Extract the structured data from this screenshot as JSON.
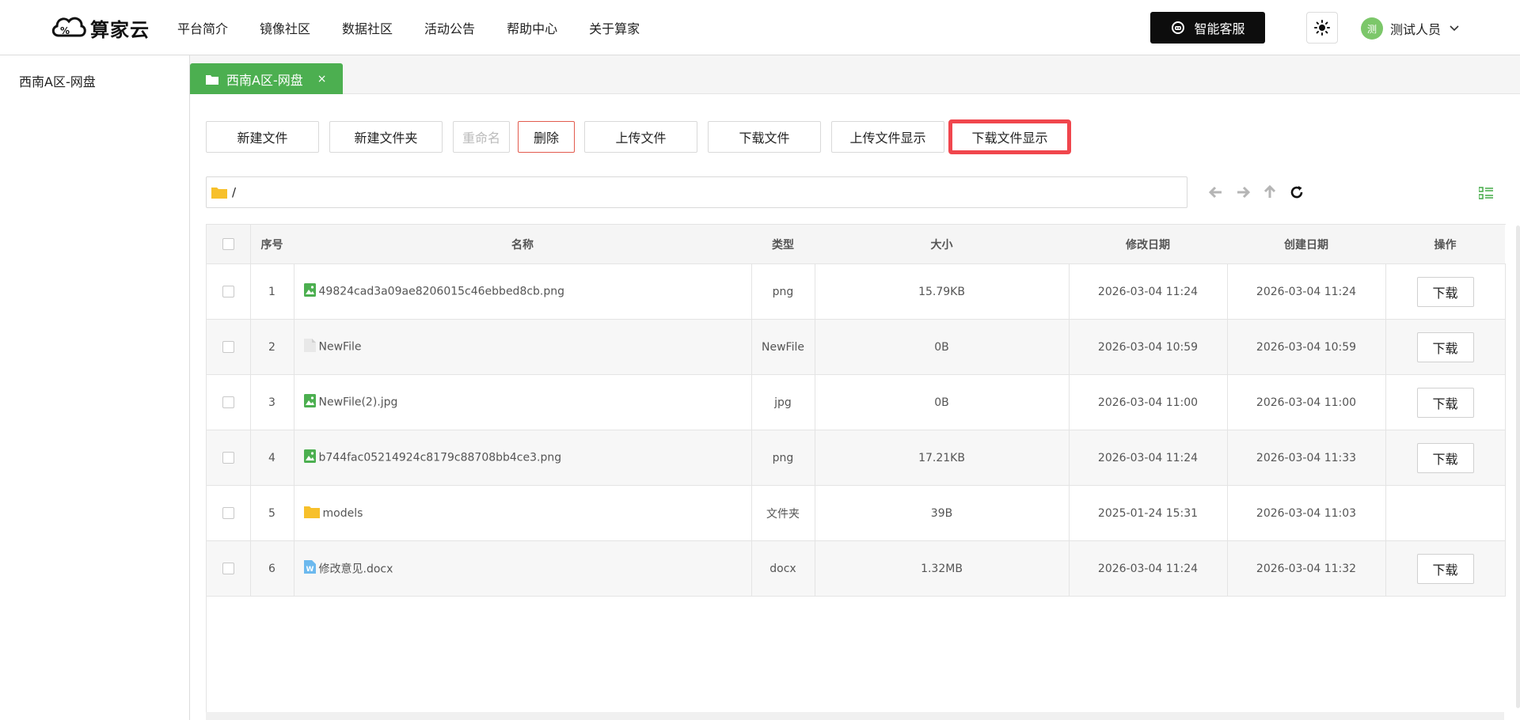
{
  "header": {
    "logo_text": "算家云",
    "nav": [
      "平台简介",
      "镜像社区",
      "数据社区",
      "活动公告",
      "帮助中心",
      "关于算家"
    ],
    "service_button": "智能客服",
    "user": {
      "avatar_text": "测",
      "name": "测试人员"
    }
  },
  "sidebar": {
    "items": [
      {
        "label": "西南A区-网盘"
      }
    ]
  },
  "tabs": [
    {
      "label": "西南A区-网盘",
      "close": "×"
    }
  ],
  "toolbar": {
    "new_file": "新建文件",
    "new_folder": "新建文件夹",
    "rename": "重命名",
    "delete": "删除",
    "upload": "上传文件",
    "download": "下载文件",
    "upload_display": "上传文件显示",
    "download_display": "下载文件显示"
  },
  "path": {
    "value": "/"
  },
  "table": {
    "headers": {
      "index": "序号",
      "name": "名称",
      "type": "类型",
      "size": "大小",
      "modified": "修改日期",
      "created": "创建日期",
      "action": "操作"
    },
    "rows": [
      {
        "index": "1",
        "name": "49824cad3a09ae8206015c46ebbed8cb.png",
        "icon": "image-file-icon",
        "type": "png",
        "size": "15.79KB",
        "modified": "2026-03-04 11:24",
        "created": "2026-03-04 11:24",
        "action": "下载"
      },
      {
        "index": "2",
        "name": "NewFile",
        "icon": "blank-file-icon",
        "type": "NewFile",
        "size": "0B",
        "modified": "2026-03-04 10:59",
        "created": "2026-03-04 10:59",
        "action": "下载"
      },
      {
        "index": "3",
        "name": "NewFile(2).jpg",
        "icon": "image-file-icon",
        "type": "jpg",
        "size": "0B",
        "modified": "2026-03-04 11:00",
        "created": "2026-03-04 11:00",
        "action": "下载"
      },
      {
        "index": "4",
        "name": "b744fac05214924c8179c88708bb4ce3.png",
        "icon": "image-file-icon",
        "type": "png",
        "size": "17.21KB",
        "modified": "2026-03-04 11:24",
        "created": "2026-03-04 11:33",
        "action": "下载"
      },
      {
        "index": "5",
        "name": "models",
        "icon": "folder-icon",
        "type": "文件夹",
        "size": "39B",
        "modified": "2025-01-24 15:31",
        "created": "2026-03-04 11:03",
        "action": ""
      },
      {
        "index": "6",
        "name": "修改意见.docx",
        "icon": "word-file-icon",
        "type": "docx",
        "size": "1.32MB",
        "modified": "2026-03-04 11:24",
        "created": "2026-03-04 11:32",
        "action": "下载"
      }
    ]
  },
  "colors": {
    "accent_green": "#4caf50",
    "highlight_red": "#f0464d",
    "danger_border": "#e25b4e",
    "folder_yellow": "#f7c02b"
  }
}
